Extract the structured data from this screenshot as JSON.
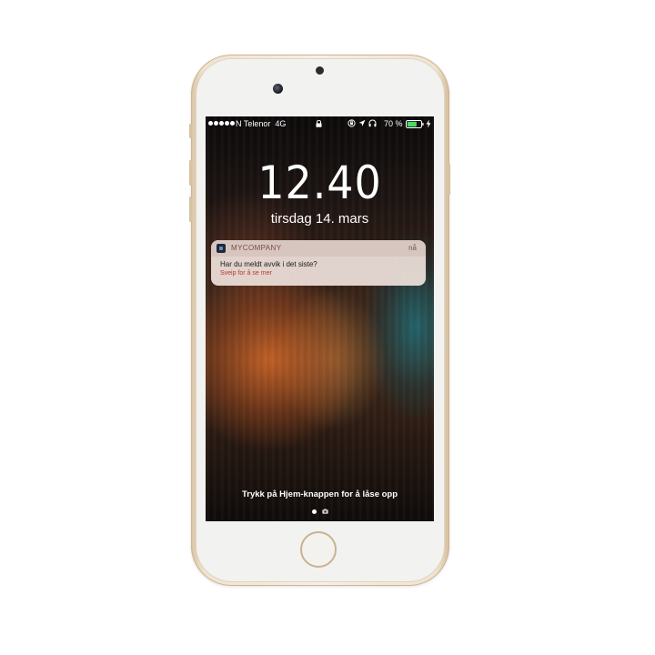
{
  "status_bar": {
    "carrier": "N Telenor",
    "network": "4G",
    "signal_bars_filled": 5,
    "battery_percent": "70 %",
    "battery_level": 0.7,
    "icons": [
      "lock-icon",
      "rotation-lock-icon",
      "location-arrow-icon",
      "headphones-icon",
      "battery-icon",
      "charging-bolt-icon"
    ]
  },
  "lock_screen": {
    "time": "12.40",
    "date": "tirsdag 14. mars",
    "unlock_hint": "Trykk på Hjem-knappen for å låse opp"
  },
  "notification": {
    "app_name": "MYCOMPANY",
    "time": "nå",
    "title": "Har du meldt avvik i det siste?",
    "subtitle": "Sveip for å se mer"
  },
  "page_indicator": {
    "current_page": 1,
    "icons": [
      "page-dot",
      "camera-icon"
    ]
  },
  "colors": {
    "notification_accent": "#b53b2c",
    "phone_body": "#efe3d2",
    "battery_fill": "#4cd964"
  }
}
